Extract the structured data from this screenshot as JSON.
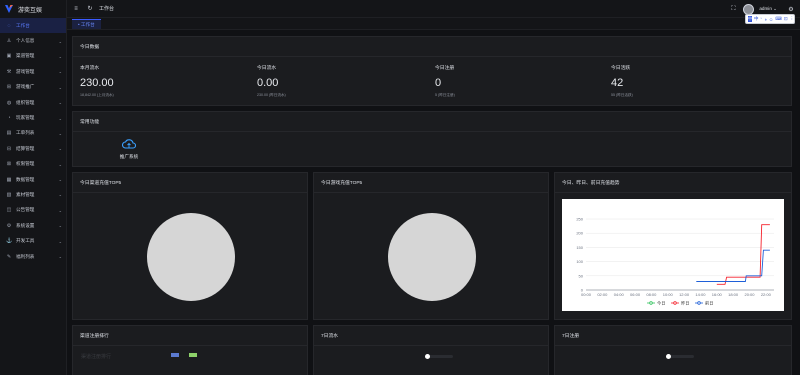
{
  "app": {
    "name": "游奕互娱"
  },
  "sidebar": {
    "items": [
      {
        "label": "工作台",
        "icon": "dashboard-icon",
        "glyph": "◌",
        "active": true
      },
      {
        "label": "个人信息",
        "icon": "user-icon",
        "glyph": "♙",
        "arrow": "⌄"
      },
      {
        "label": "渠道管理",
        "icon": "channel-icon",
        "glyph": "▣",
        "arrow": "⌄"
      },
      {
        "label": "游戏管理",
        "icon": "wrench-icon",
        "glyph": "⚒",
        "arrow": "⌄"
      },
      {
        "label": "游戏推广",
        "icon": "promote-icon",
        "glyph": "⊞",
        "arrow": "⌄"
      },
      {
        "label": "组织管理",
        "icon": "org-icon",
        "glyph": "◍",
        "arrow": "⌄"
      },
      {
        "label": "玩家管理",
        "icon": "player-icon",
        "glyph": "◔",
        "arrow": "⌄"
      },
      {
        "label": "工单列表",
        "icon": "ticket-icon",
        "glyph": "▤",
        "arrow": "⌄"
      },
      {
        "label": "结算管理",
        "icon": "settle-icon",
        "glyph": "⊟",
        "arrow": "⌄"
      },
      {
        "label": "权限管理",
        "icon": "permission-icon",
        "glyph": "⊠",
        "arrow": "⌄"
      },
      {
        "label": "数据管理",
        "icon": "data-icon",
        "glyph": "▦",
        "arrow": "⌄"
      },
      {
        "label": "素材管理",
        "icon": "material-icon",
        "glyph": "▧",
        "arrow": "⌄"
      },
      {
        "label": "公告管理",
        "icon": "notice-icon",
        "glyph": "◫",
        "arrow": "⌄"
      },
      {
        "label": "系统设置",
        "icon": "settings-icon",
        "glyph": "⚙",
        "arrow": "⌄"
      },
      {
        "label": "开发工具",
        "icon": "dev-tool-icon",
        "glyph": "⚓",
        "arrow": "⌄"
      },
      {
        "label": "福利列表",
        "icon": "gift-icon",
        "glyph": "✎",
        "arrow": "⌄"
      }
    ]
  },
  "header": {
    "menu_icon": "≡",
    "refresh_icon": "↻",
    "breadcrumb": "工作台",
    "fullscreen_icon": "⛶",
    "user": "admin ⌄",
    "settings_icon": "⚙"
  },
  "tabs": [
    {
      "label": "• 工作台"
    }
  ],
  "tab_chevron": "⌄",
  "ime": {
    "box": "中",
    "items": [
      "中",
      "ˇ",
      "◑",
      "☺",
      "⌨",
      "⊡",
      "⋮"
    ]
  },
  "today": {
    "title": "今日数据",
    "stats": [
      {
        "label": "本月流水",
        "value": "230.00",
        "sub": "18,842.00 (上月流水)"
      },
      {
        "label": "今日流水",
        "value": "0.00",
        "sub": "230.00 (昨日流水)"
      },
      {
        "label": "今日注册",
        "value": "0",
        "sub": "5 (昨日注册)"
      },
      {
        "label": "今日活跃",
        "value": "42",
        "sub": "55 (昨日活跃)"
      }
    ]
  },
  "functions": {
    "title": "常用功能",
    "items": [
      {
        "label": "推广系统",
        "icon": "cloud-icon"
      }
    ]
  },
  "channel_top5": {
    "title": "今日渠道充值TOP5"
  },
  "game_top5": {
    "title": "今日游戏充值TOP5"
  },
  "trend": {
    "title": "今日、昨日、前日充值趋势"
  },
  "rank": {
    "title": "渠道注册排行",
    "ghost": "渠道注册排行"
  },
  "flow7": {
    "title": "7日流水"
  },
  "reg7": {
    "title": "7日注册"
  },
  "colors": {
    "accent": "#5b7cff",
    "today": "#2fc25b",
    "yesterday": "#f5222d",
    "before": "#1e5fd8"
  },
  "chart_data": {
    "type": "line",
    "x": [
      "00:00",
      "02:00",
      "04:00",
      "06:00",
      "08:00",
      "10:00",
      "12:00",
      "14:00",
      "16:00",
      "18:00",
      "20:00",
      "22:00"
    ],
    "yticks": [
      0,
      50,
      100,
      150,
      200,
      250
    ],
    "ylim": [
      0,
      250
    ],
    "legend": "bottom",
    "series": [
      {
        "name": "今日",
        "color": "#2fc25b",
        "points": []
      },
      {
        "name": "昨日",
        "color": "#f5222d",
        "points": [
          [
            16,
            20
          ],
          [
            17,
            20
          ],
          [
            17.2,
            45
          ],
          [
            21.3,
            45
          ],
          [
            21.5,
            230
          ],
          [
            22.5,
            230
          ]
        ]
      },
      {
        "name": "前日",
        "color": "#1e5fd8",
        "points": [
          [
            13.5,
            30
          ],
          [
            19.5,
            30
          ],
          [
            19.6,
            50
          ],
          [
            21.5,
            50
          ],
          [
            21.7,
            140
          ],
          [
            22.5,
            140
          ]
        ]
      }
    ]
  }
}
